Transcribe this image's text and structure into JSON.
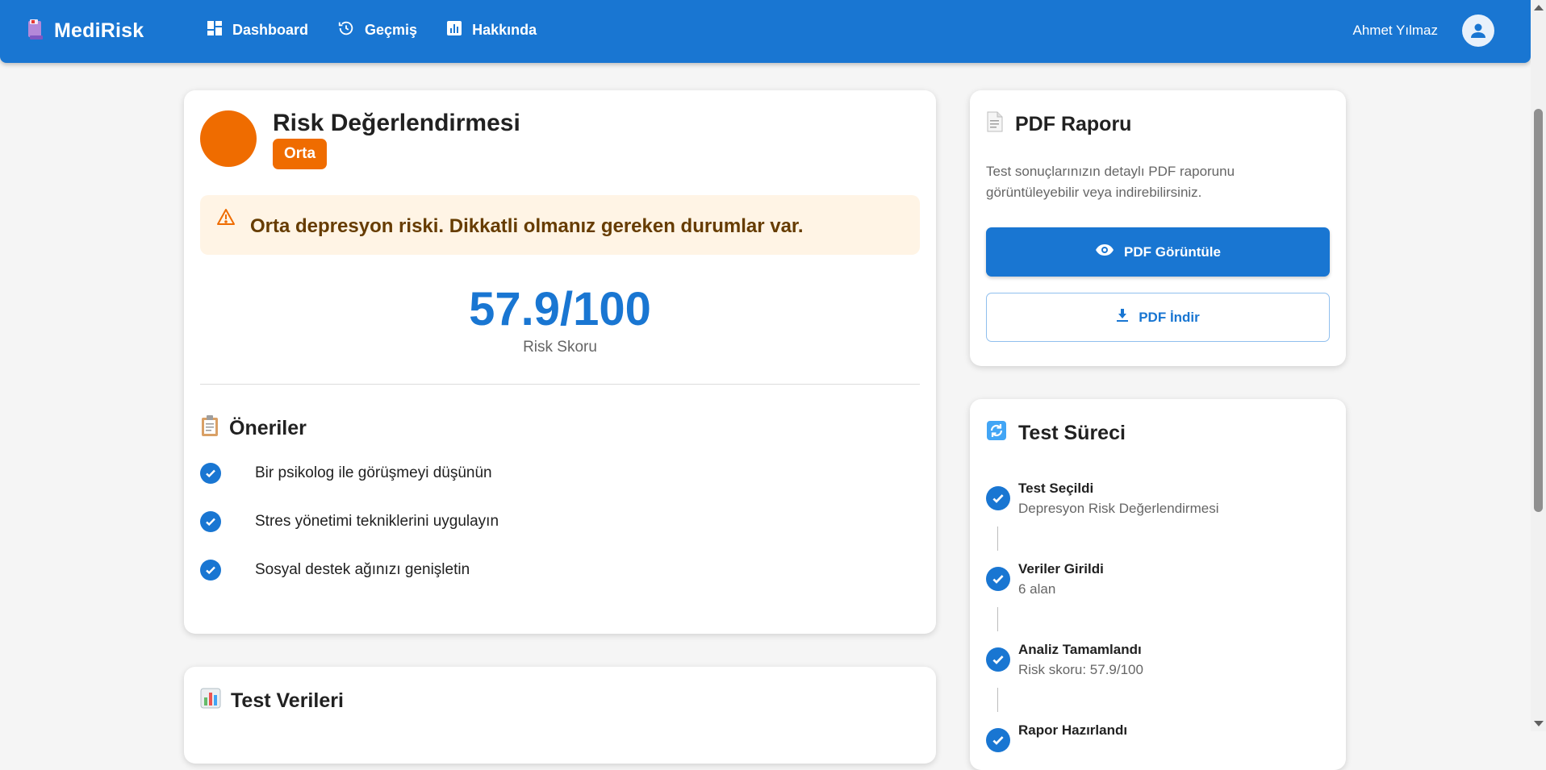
{
  "header": {
    "brand": "MediRisk",
    "nav": [
      {
        "label": "Dashboard",
        "icon": "dashboard-icon"
      },
      {
        "label": "Geçmiş",
        "icon": "history-icon"
      },
      {
        "label": "Hakkında",
        "icon": "chart-icon"
      }
    ],
    "user_name": "Ahmet Yılmaz"
  },
  "risk": {
    "title": "Risk Değerlendirmesi",
    "level": "Orta",
    "level_color": "#ef6c00",
    "alert": "Orta depresyon riski. Dikkatli olmanız gereken durumlar var.",
    "score": "57.9/100",
    "score_label": "Risk Skoru"
  },
  "recommendations": {
    "title": "Öneriler",
    "items": [
      "Bir psikolog ile görüşmeyi düşünün",
      "Stres yönetimi tekniklerini uygulayın",
      "Sosyal destek ağınızı genişletin"
    ]
  },
  "test_data": {
    "title": "Test Verileri"
  },
  "pdf": {
    "title": "PDF Raporu",
    "description": "Test sonuçlarınızın detaylı PDF raporunu görüntüleyebilir veya indirebilirsiniz.",
    "view_label": "PDF Görüntüle",
    "download_label": "PDF İndir"
  },
  "process": {
    "title": "Test Süreci",
    "steps": [
      {
        "title": "Test Seçildi",
        "desc": "Depresyon Risk Değerlendirmesi"
      },
      {
        "title": "Veriler Girildi",
        "desc": "6 alan"
      },
      {
        "title": "Analiz Tamamlandı",
        "desc": "Risk skoru: 57.9/100"
      },
      {
        "title": "Rapor Hazırlandı",
        "desc": ""
      }
    ]
  },
  "colors": {
    "primary": "#1976d2",
    "warning": "#ef6c00",
    "alert_bg": "#fff4e5"
  }
}
